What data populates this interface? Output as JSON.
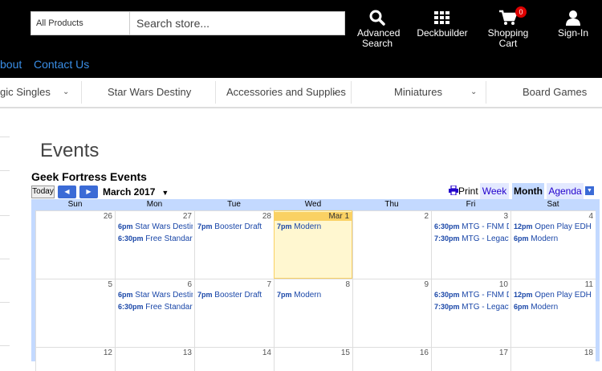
{
  "header": {
    "category_select": "All Products",
    "search_placeholder": "Search store...",
    "advanced_search": [
      "Advanced",
      "Search"
    ],
    "deckbuilder": "Deckbuilder",
    "cart": [
      "Shopping",
      "Cart"
    ],
    "cart_count": "0",
    "signin": "Sign-In"
  },
  "links": {
    "about": "bout",
    "contact": "Contact Us"
  },
  "category_nav": [
    "gic Singles",
    "Star Wars Destiny",
    "Accessories and Supplies",
    "Miniatures",
    "Board Games"
  ],
  "page_title": "Events",
  "calendar": {
    "title": "Geek Fortress Events",
    "today": "Today",
    "month": "March 2017",
    "print": "Print",
    "views": [
      "Week",
      "Month",
      "Agenda"
    ],
    "daynames": [
      "Sun",
      "Mon",
      "Tue",
      "Wed",
      "Thu",
      "Fri",
      "Sat"
    ],
    "week1": {
      "dates": [
        "26",
        "27",
        "28",
        "Mar 1",
        "2",
        "3",
        "4"
      ],
      "events": [
        [],
        [
          {
            "t": "6pm",
            "n": "Star Wars Destin"
          },
          {
            "t": "6:30pm",
            "n": "Free Standard"
          }
        ],
        [
          {
            "t": "7pm",
            "n": "Booster Draft"
          }
        ],
        [
          {
            "t": "7pm",
            "n": "Modern"
          }
        ],
        [],
        [
          {
            "t": "6:30pm",
            "n": "MTG - FNM Dr"
          },
          {
            "t": "7:30pm",
            "n": "MTG - Legacy"
          }
        ],
        [
          {
            "t": "12pm",
            "n": "Open Play EDH"
          },
          {
            "t": "6pm",
            "n": "Modern"
          }
        ]
      ]
    },
    "week2": {
      "dates": [
        "5",
        "6",
        "7",
        "8",
        "9",
        "10",
        "11"
      ],
      "events": [
        [],
        [
          {
            "t": "6pm",
            "n": "Star Wars Destin"
          },
          {
            "t": "6:30pm",
            "n": "Free Standard"
          }
        ],
        [
          {
            "t": "7pm",
            "n": "Booster Draft"
          }
        ],
        [
          {
            "t": "7pm",
            "n": "Modern"
          }
        ],
        [],
        [
          {
            "t": "6:30pm",
            "n": "MTG - FNM Dr"
          },
          {
            "t": "7:30pm",
            "n": "MTG - Legacy"
          }
        ],
        [
          {
            "t": "12pm",
            "n": "Open Play EDH"
          },
          {
            "t": "6pm",
            "n": "Modern"
          }
        ]
      ]
    },
    "week3": {
      "dates": [
        "12",
        "13",
        "14",
        "15",
        "16",
        "17",
        "18"
      ]
    }
  },
  "colors": {
    "accent": "#3b6bd6",
    "link": "#3a8ee6",
    "today_bg": "#fff7d0",
    "grid_bg": "#c3d9ff"
  }
}
